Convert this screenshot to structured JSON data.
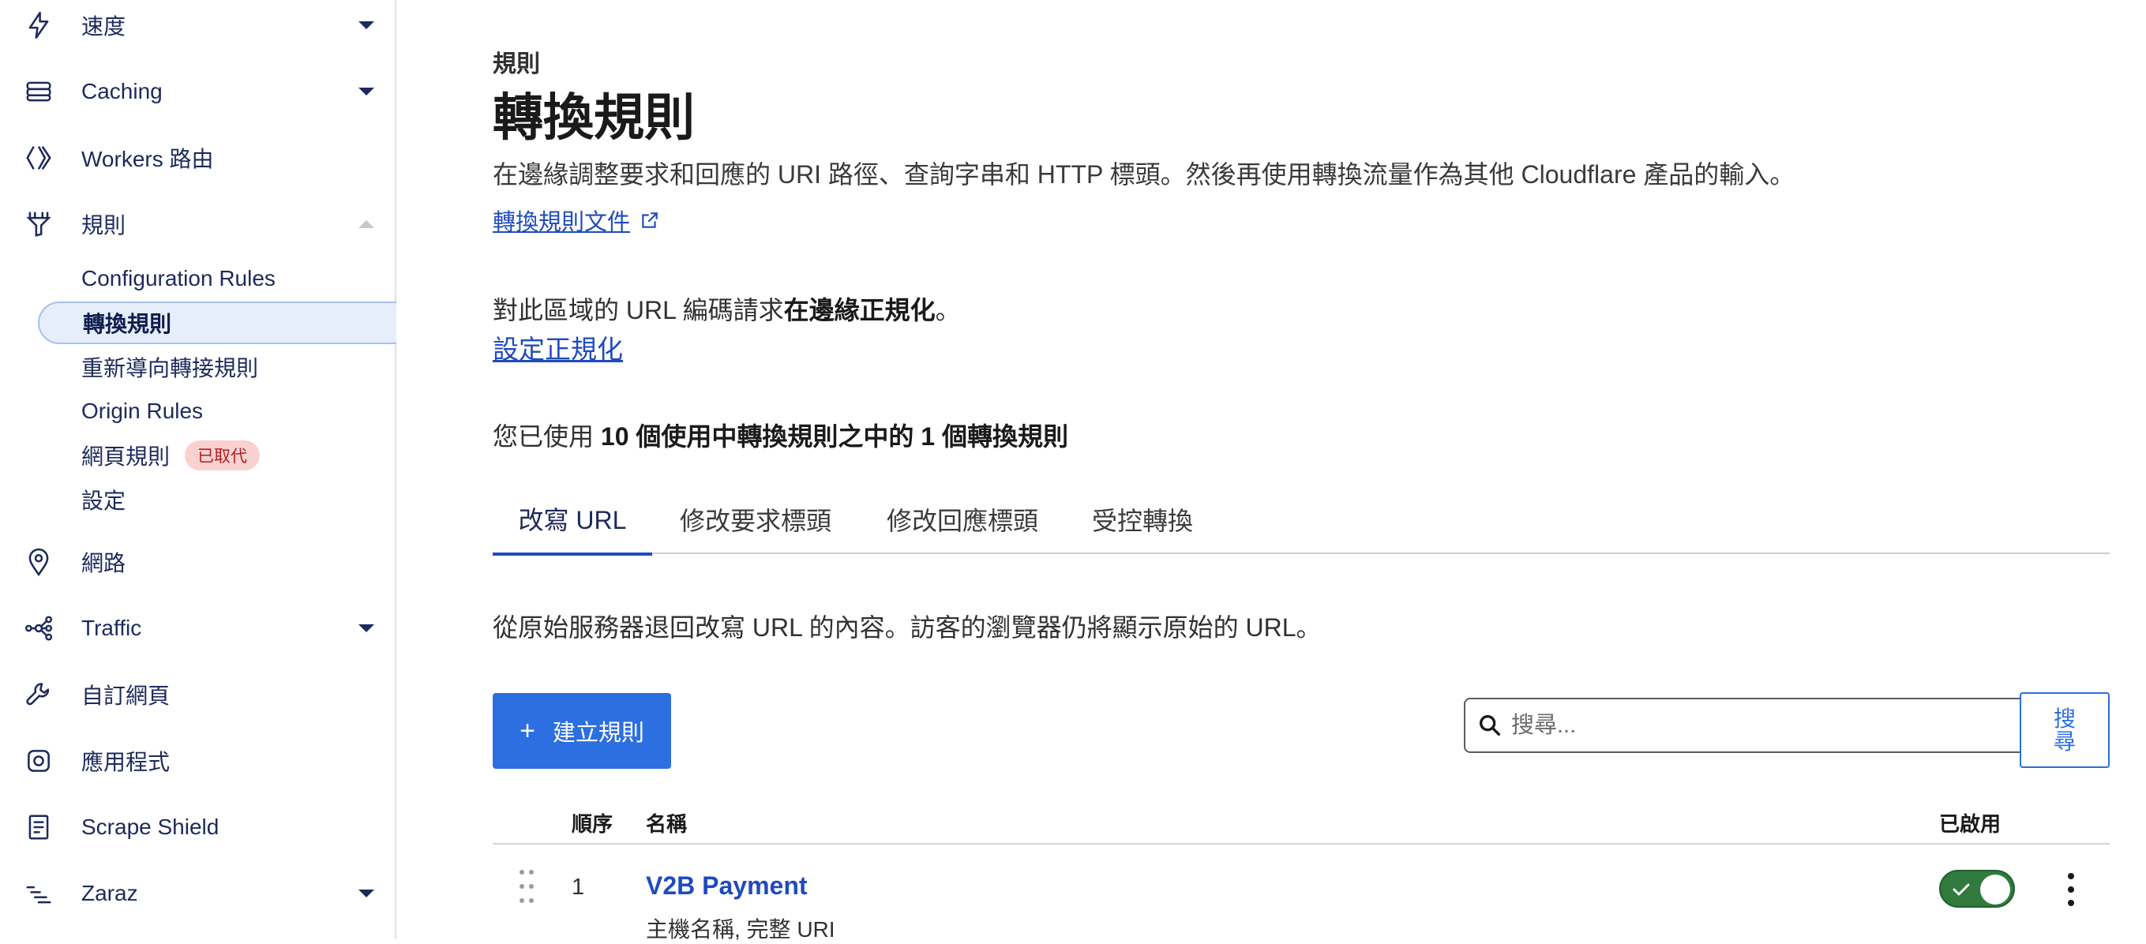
{
  "sidebar": {
    "items": [
      {
        "label": "速度",
        "icon": "lightning-icon",
        "expandable": true
      },
      {
        "label": "Caching",
        "icon": "database-stack-icon",
        "expandable": true
      },
      {
        "label": "Workers 路由",
        "icon": "workers-diamond-icon",
        "expandable": false
      },
      {
        "label": "規則",
        "icon": "funnel-rules-icon",
        "expandable": true,
        "expanded": true
      },
      {
        "label": "網路",
        "icon": "location-pin-icon",
        "expandable": false
      },
      {
        "label": "Traffic",
        "icon": "traffic-share-icon",
        "expandable": true
      },
      {
        "label": "自訂網頁",
        "icon": "wrench-icon",
        "expandable": false
      },
      {
        "label": "應用程式",
        "icon": "apps-circle-icon",
        "expandable": false
      },
      {
        "label": "Scrape Shield",
        "icon": "document-icon",
        "expandable": false
      },
      {
        "label": "Zaraz",
        "icon": "zaraz-lines-icon",
        "expandable": true
      }
    ],
    "rules_subitems": [
      {
        "label": "Configuration Rules"
      },
      {
        "label": "轉換規則",
        "active": true
      },
      {
        "label": "重新導向轉接規則"
      },
      {
        "label": "Origin Rules"
      },
      {
        "label": "網頁規則",
        "badge": "已取代"
      },
      {
        "label": "設定"
      }
    ]
  },
  "page": {
    "eyebrow": "規則",
    "title": "轉換規則",
    "description": "在邊緣調整要求和回應的 URI 路徑、查詢字串和 HTTP 標頭。然後再使用轉換流量作為其他 Cloudflare 產品的輸入。",
    "doc_link": "轉換規則文件"
  },
  "normalization": {
    "text_prefix": "對此區域的 URL 編碼請求",
    "text_bold": "在邊緣正規化",
    "text_suffix": "。",
    "link": "設定正規化"
  },
  "usage": {
    "prefix": "您已使用 ",
    "bold": "10 個使用中轉換規則之中的 1 個轉換規則"
  },
  "tabs": [
    {
      "label": "改寫 URL",
      "active": true
    },
    {
      "label": "修改要求標頭"
    },
    {
      "label": "修改回應標頭"
    },
    {
      "label": "受控轉換"
    }
  ],
  "tab_description": "從原始服務器退回改寫 URL 的內容。訪客的瀏覽器仍將顯示原始的 URL。",
  "actions": {
    "create_button": "建立規則",
    "search_placeholder": "搜尋...",
    "search_button": "搜尋"
  },
  "table": {
    "headers": {
      "order": "順序",
      "name": "名稱",
      "enabled": "已啟用"
    },
    "rows": [
      {
        "order": "1",
        "name": "V2B Payment",
        "subtitle": "主機名稱, 完整 URI",
        "enabled": true
      }
    ]
  },
  "colors": {
    "accent": "#2c6fe0",
    "link": "#1f4bbd",
    "toggle_on": "#2f7a3c",
    "badge_bg": "#f9d1d1",
    "badge_text": "#b31e1e"
  }
}
